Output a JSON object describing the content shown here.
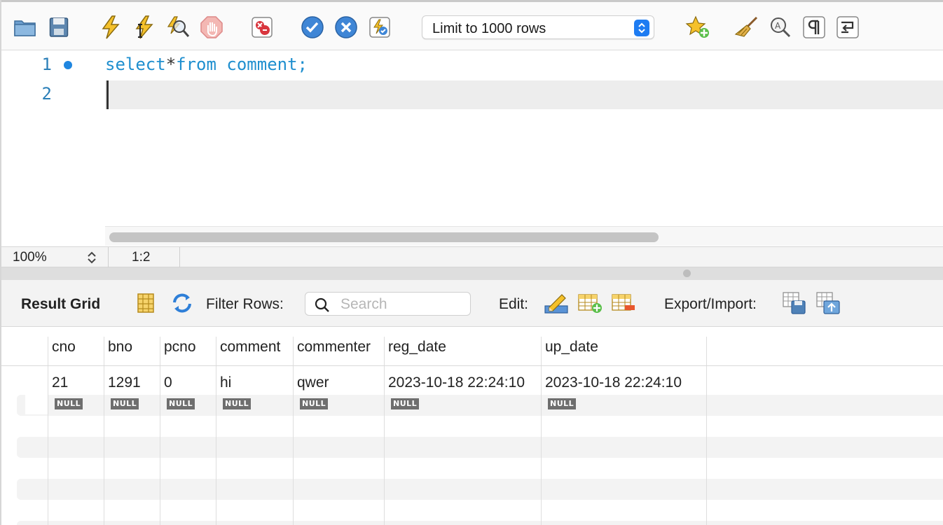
{
  "toolbar": {
    "limit_select": {
      "label": "Limit to 1000 rows"
    }
  },
  "editor": {
    "lines": [
      {
        "number": "1",
        "keyword1": "select",
        "star": "*",
        "keyword2": "from",
        "rest": " comment;"
      },
      {
        "number": "2"
      }
    ]
  },
  "status": {
    "zoom": "100%",
    "cursor_position": "1:2"
  },
  "result_bar": {
    "title": "Result Grid",
    "filter_label": "Filter Rows:",
    "search_placeholder": "Search",
    "edit_label": "Edit:",
    "export_label": "Export/Import:"
  },
  "grid": {
    "columns": [
      "cno",
      "bno",
      "pcno",
      "comment",
      "commenter",
      "reg_date",
      "up_date"
    ],
    "rows": [
      [
        "21",
        "1291",
        "0",
        "hi",
        "qwer",
        "2023-10-18 22:24:10",
        "2023-10-18 22:24:10"
      ]
    ],
    "new_row": [
      "NULL",
      "NULL",
      "NULL",
      "NULL",
      "NULL",
      "NULL",
      "NULL"
    ]
  },
  "colors": {
    "keyword": "#1f8fcf",
    "line_number": "#2b7fb8",
    "select_accent": "#1e7cf2",
    "null_badge": "#6e6e6e"
  }
}
